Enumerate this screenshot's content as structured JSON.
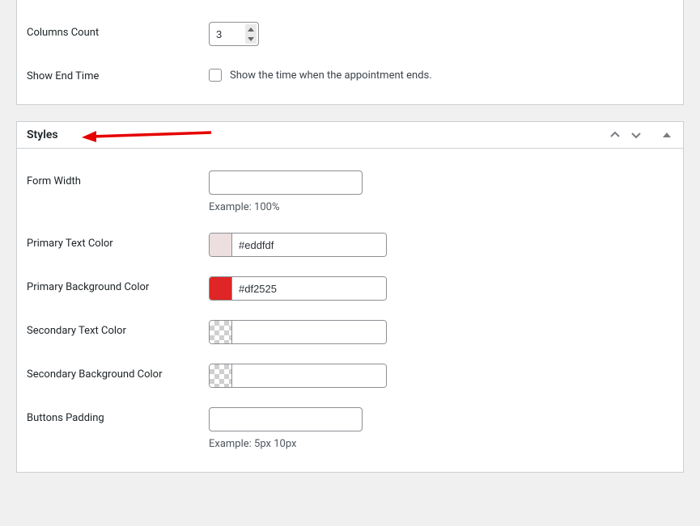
{
  "top_panel": {
    "columns_count": {
      "label": "Columns Count",
      "value": "3"
    },
    "show_end_time": {
      "label": "Show End Time",
      "checkbox_label": "Show the time when the appointment ends.",
      "checked": false
    }
  },
  "styles_panel": {
    "title": "Styles",
    "form_width": {
      "label": "Form Width",
      "value": "",
      "hint": "Example: 100%"
    },
    "primary_text_color": {
      "label": "Primary Text Color",
      "hex": "#eddfdf",
      "swatch": "#eddfdf"
    },
    "primary_bg_color": {
      "label": "Primary Background Color",
      "hex": "#df2525",
      "swatch": "#df2525"
    },
    "secondary_text_color": {
      "label": "Secondary Text Color",
      "hex": "",
      "swatch": "transparent"
    },
    "secondary_bg_color": {
      "label": "Secondary Background Color",
      "hex": "",
      "swatch": "transparent"
    },
    "buttons_padding": {
      "label": "Buttons Padding",
      "value": "",
      "hint": "Example: 5px 10px"
    }
  }
}
